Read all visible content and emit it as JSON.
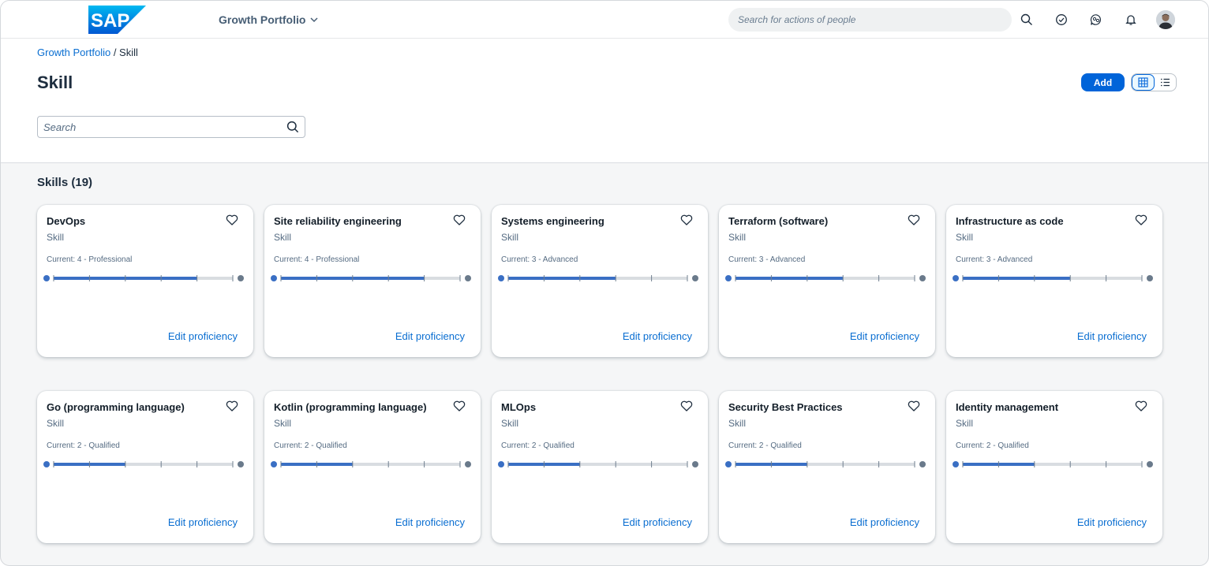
{
  "shell": {
    "logo_text": "SAP",
    "product_name": "Growth Portfolio",
    "search_placeholder": "Search for actions of people",
    "icons": [
      "search-icon",
      "check-circle-icon",
      "feedback-icon",
      "bell-icon"
    ]
  },
  "breadcrumb": {
    "parent": "Growth Portfolio",
    "separator": " / ",
    "current": "Skill"
  },
  "page": {
    "title": "Skill",
    "add_label": "Add",
    "search_placeholder": "Search"
  },
  "section": {
    "title": "Skills (19)"
  },
  "colors": {
    "brand_blue": "#0064d9",
    "link_blue": "#0a6ed1",
    "meter_fill": "#3a6fc4",
    "meter_track": "#d9dde1",
    "meter_end": "#6a7a8b"
  },
  "meter_levels": 5,
  "cards": [
    {
      "title": "DevOps",
      "subtitle": "Skill",
      "current": "Current: 4 - Professional",
      "level": 4,
      "link": "Edit proficiency"
    },
    {
      "title": "Site reliability engineering",
      "subtitle": "Skill",
      "current": "Current: 4 - Professional",
      "level": 4,
      "link": "Edit proficiency"
    },
    {
      "title": "Systems engineering",
      "subtitle": "Skill",
      "current": "Current: 3 - Advanced",
      "level": 3,
      "link": "Edit proficiency"
    },
    {
      "title": "Terraform (software)",
      "subtitle": "Skill",
      "current": "Current: 3 - Advanced",
      "level": 3,
      "link": "Edit proficiency"
    },
    {
      "title": "Infrastructure as code",
      "subtitle": "Skill",
      "current": "Current: 3 - Advanced",
      "level": 3,
      "link": "Edit proficiency"
    },
    {
      "title": "Go (programming language)",
      "subtitle": "Skill",
      "current": "Current: 2 - Qualified",
      "level": 2,
      "link": "Edit proficiency"
    },
    {
      "title": "Kotlin (programming language)",
      "subtitle": "Skill",
      "current": "Current: 2 - Qualified",
      "level": 2,
      "link": "Edit proficiency"
    },
    {
      "title": "MLOps",
      "subtitle": "Skill",
      "current": "Current: 2 - Qualified",
      "level": 2,
      "link": "Edit proficiency"
    },
    {
      "title": "Security Best Practices",
      "subtitle": "Skill",
      "current": "Current: 2 - Qualified",
      "level": 2,
      "link": "Edit proficiency"
    },
    {
      "title": "Identity management",
      "subtitle": "Skill",
      "current": "Current: 2 - Qualified",
      "level": 2,
      "link": "Edit proficiency"
    }
  ]
}
